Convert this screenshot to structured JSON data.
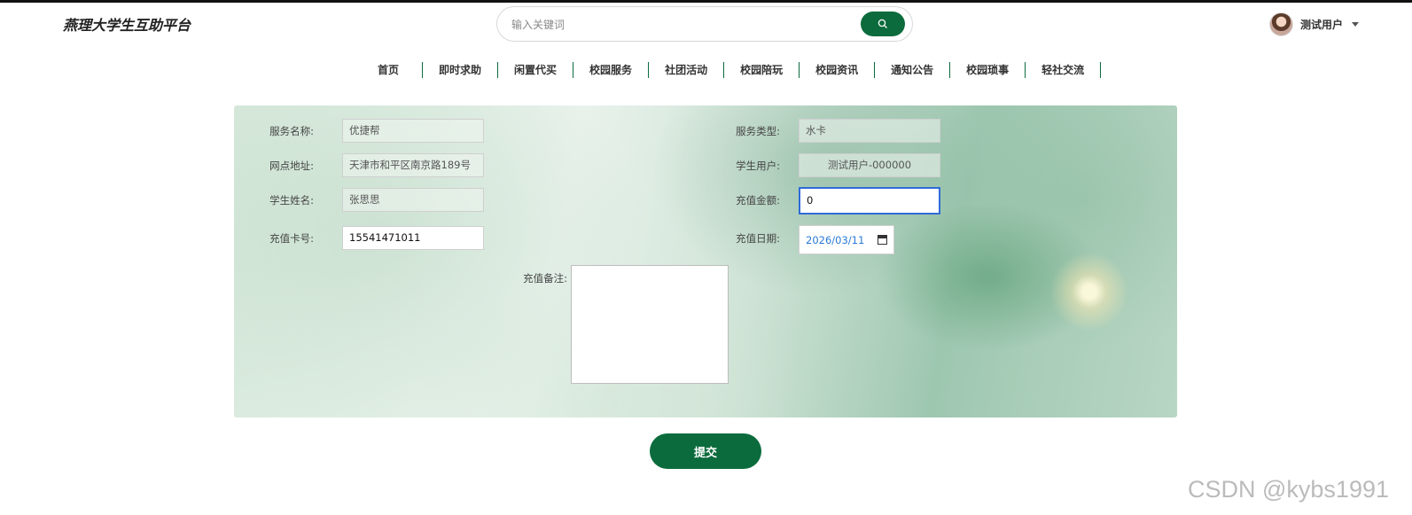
{
  "site": {
    "title": "燕理大学生互助平台"
  },
  "search": {
    "placeholder": "输入关键词"
  },
  "user": {
    "name": "测试用户"
  },
  "nav": [
    {
      "label": "首页"
    },
    {
      "label": "即时求助"
    },
    {
      "label": "闲置代买"
    },
    {
      "label": "校园服务"
    },
    {
      "label": "社团活动"
    },
    {
      "label": "校园陪玩"
    },
    {
      "label": "校园资讯"
    },
    {
      "label": "通知公告"
    },
    {
      "label": "校园琐事"
    },
    {
      "label": "轻社交流"
    }
  ],
  "form": {
    "service_name": {
      "label": "服务名称:",
      "value": "优捷帮"
    },
    "service_type": {
      "label": "服务类型:",
      "value": "水卡"
    },
    "address": {
      "label": "网点地址:",
      "value": "天津市和平区南京路189号"
    },
    "student_user": {
      "label": "学生用户:",
      "value": "测试用户-000000"
    },
    "student_name": {
      "label": "学生姓名:",
      "value": "张思思"
    },
    "amount": {
      "label": "充值金额:",
      "value": "0"
    },
    "card_no": {
      "label": "充值卡号:",
      "value": "15541471011"
    },
    "date": {
      "label": "充值日期:",
      "value": "2026/03/11"
    },
    "remark": {
      "label": "充值备注:",
      "value": ""
    },
    "submit_label": "提交"
  },
  "watermark": "CSDN @kybs1991",
  "colors": {
    "primary": "#0b6b3c",
    "focus": "#2f6bd8"
  }
}
